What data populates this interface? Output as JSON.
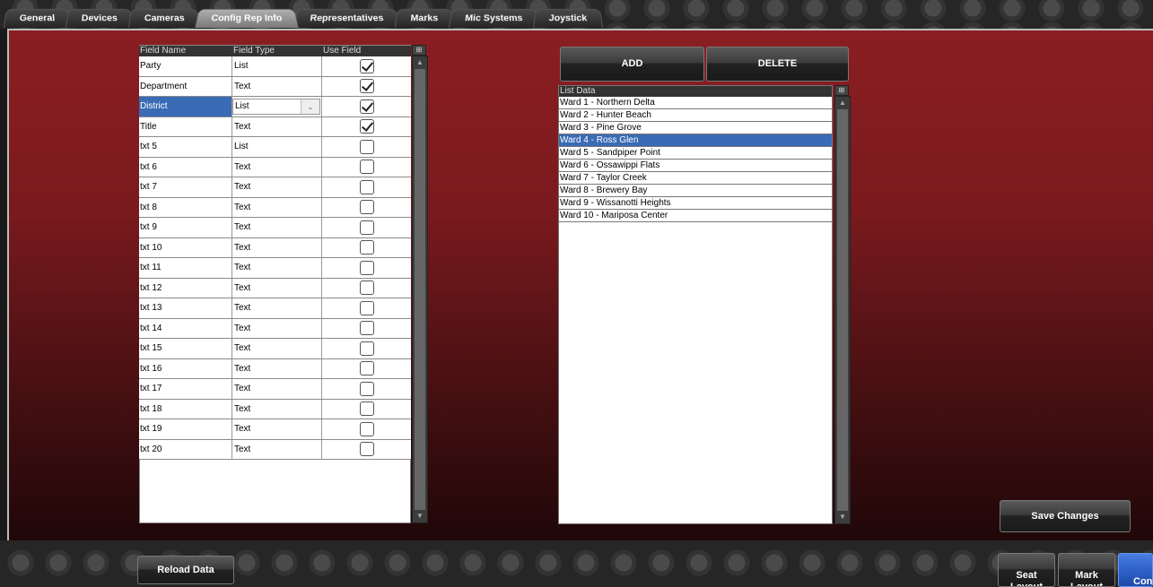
{
  "tabs": [
    "General",
    "Devices",
    "Cameras",
    "Config Rep Info",
    "Representatives",
    "Marks",
    "Mic Systems",
    "Joystick"
  ],
  "active_tab": "Config Rep Info",
  "fields_grid": {
    "headers": {
      "field_name": "Field Name",
      "field_type": "Field Type",
      "use_field": "Use Field"
    },
    "rows": [
      {
        "name": "Party",
        "type": "List",
        "use": true
      },
      {
        "name": "Department",
        "type": "Text",
        "use": true
      },
      {
        "name": "District",
        "type": "List",
        "use": true,
        "selected": true
      },
      {
        "name": "Title",
        "type": "Text",
        "use": true
      },
      {
        "name": "txt 5",
        "type": "List",
        "use": false
      },
      {
        "name": "txt 6",
        "type": "Text",
        "use": false
      },
      {
        "name": "txt 7",
        "type": "Text",
        "use": false
      },
      {
        "name": "txt 8",
        "type": "Text",
        "use": false
      },
      {
        "name": "txt 9",
        "type": "Text",
        "use": false
      },
      {
        "name": "txt 10",
        "type": "Text",
        "use": false
      },
      {
        "name": "txt 11",
        "type": "Text",
        "use": false
      },
      {
        "name": "txt 12",
        "type": "Text",
        "use": false
      },
      {
        "name": "txt 13",
        "type": "Text",
        "use": false
      },
      {
        "name": "txt 14",
        "type": "Text",
        "use": false
      },
      {
        "name": "txt 15",
        "type": "Text",
        "use": false
      },
      {
        "name": "txt 16",
        "type": "Text",
        "use": false
      },
      {
        "name": "txt 17",
        "type": "Text",
        "use": false
      },
      {
        "name": "txt 18",
        "type": "Text",
        "use": false
      },
      {
        "name": "txt 19",
        "type": "Text",
        "use": false
      },
      {
        "name": "txt 20",
        "type": "Text",
        "use": false
      }
    ]
  },
  "buttons": {
    "add": "ADD",
    "delete": "DELETE",
    "save_changes": "Save Changes",
    "reload_data": "Reload Data",
    "seat_layout": "Seat Layout",
    "mark_layout": "Mark Layout",
    "config": "Conf"
  },
  "list_data": {
    "header": "List Data",
    "items": [
      "Ward 1 - Northern Delta",
      "Ward 2 - Hunter Beach",
      "Ward 3 - Pine Grove",
      "Ward 4 - Ross Glen",
      "Ward 5 - Sandpiper Point",
      "Ward 6 - Ossawippi Flats",
      "Ward 7 - Taylor Creek",
      "Ward 8 - Brewery Bay",
      "Ward 9 - Wissanotti Heights",
      "Ward 10 - Mariposa Center"
    ],
    "selected_index": 3
  },
  "colors": {
    "selection": "#3a6bb5",
    "panel_red": "#8a1e22",
    "config_button": "#2f62c8"
  }
}
